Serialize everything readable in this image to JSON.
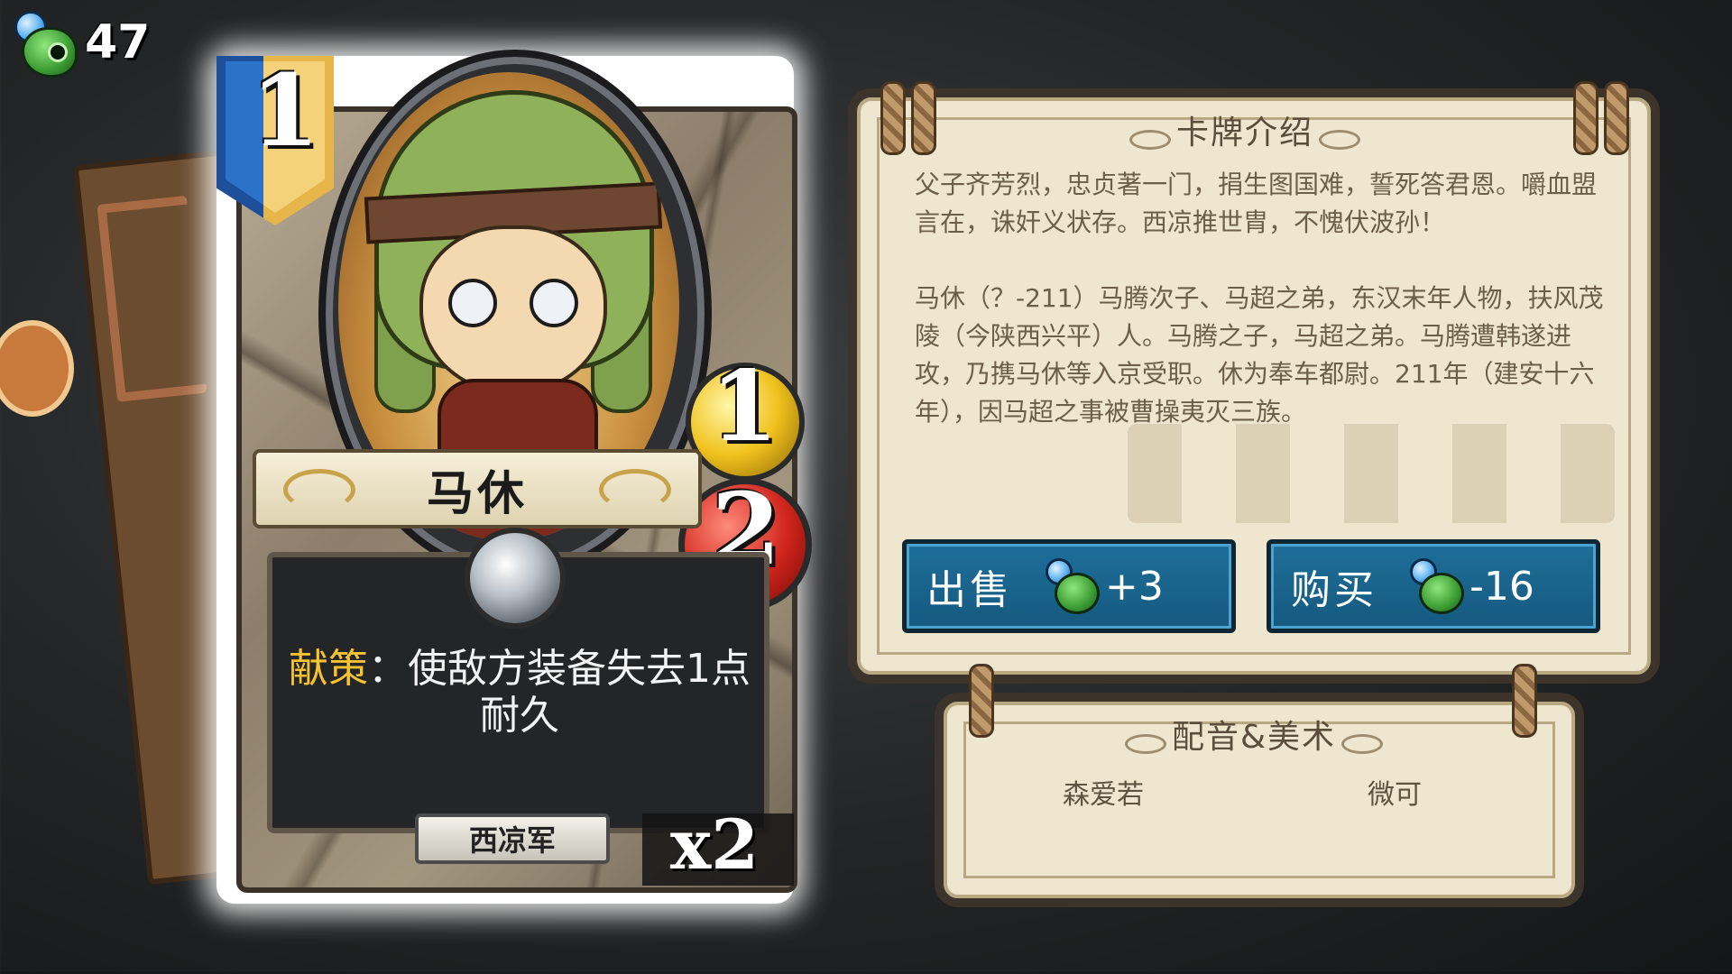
{
  "currency": {
    "icon": "gem-currency-icon",
    "value": "47"
  },
  "card": {
    "cost": "1",
    "attack": "1",
    "health": "2",
    "name": "马休",
    "ability_keyword": "献策",
    "ability_separator": "：",
    "ability_text": "使敌方装备失去1点耐久",
    "faction": "西凉军",
    "copies": "x2"
  },
  "info_panel": {
    "title": "卡牌介绍",
    "paragraph1": "父子齐芳烈，忠贞著一门，捐生图国难，誓死答君恩。嚼血盟言在，诛奸义状存。西凉推世胄，不愧伏波孙！",
    "paragraph2": "马休（？-211）马腾次子、马超之弟，东汉末年人物，扶风茂陵（今陕西兴平）人。马腾之子，马超之弟。马腾遭韩遂进攻，乃携马休等入京受职。休为奉车都尉。211年（建安十六年），因马超之事被曹操夷灭三族。"
  },
  "actions": {
    "sell": {
      "label": "出售",
      "delta": "+3"
    },
    "buy": {
      "label": "购买",
      "delta": "-16"
    }
  },
  "credits": {
    "title": "配音&美术",
    "voice": "森爱若",
    "art": "微可"
  },
  "colors": {
    "button_blue": "#1e6f9a",
    "panel_parchment": "#efe6cf",
    "keyword_gold": "#f5c332"
  }
}
